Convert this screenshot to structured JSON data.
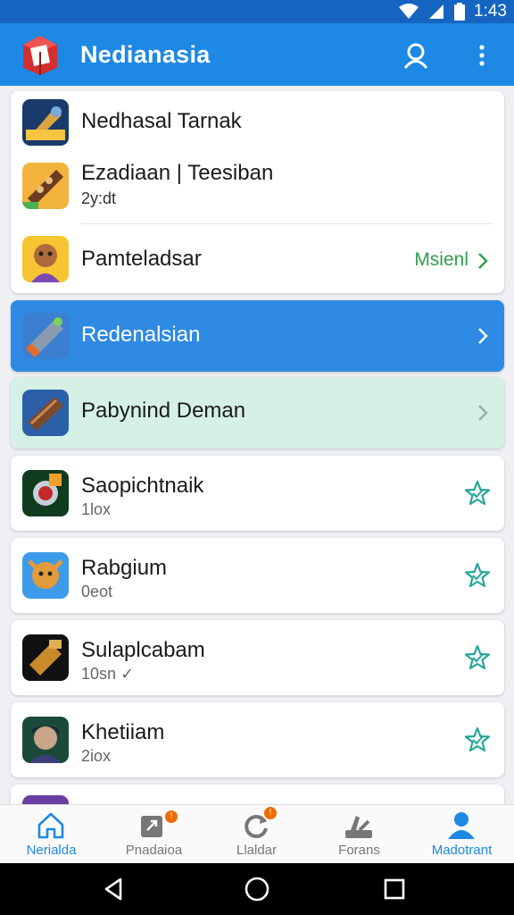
{
  "status_bar": {
    "time": "1:43"
  },
  "app_bar": {
    "title": "Nedianasia"
  },
  "list": {
    "group_card": {
      "header_title": "Nedhasal Tarnak",
      "item1_title": "Ezadiaan | Teesiban",
      "item1_sub": "2y:dt",
      "item2_title": "Pamteladsar",
      "item2_action": "Msienl"
    },
    "selected_row_title": "Redenalsian",
    "highlight_row_title": "Pabynind Deman",
    "items": [
      {
        "title": "Saopichtnaik",
        "sub": "1lox"
      },
      {
        "title": "Rabgium",
        "sub": "0eot"
      },
      {
        "title": "Sulaplcabam",
        "sub": "10sn ✓"
      },
      {
        "title": "Khetiiam",
        "sub": "2iox"
      }
    ]
  },
  "bottom_nav": {
    "items": [
      {
        "label": "Nerialda"
      },
      {
        "label": "Pnadaioa",
        "badge": "!"
      },
      {
        "label": "Llaldar",
        "badge": "!"
      },
      {
        "label": "Forans"
      },
      {
        "label": "Madotrant"
      }
    ]
  },
  "colors": {
    "primary": "#1e88e5",
    "status_bar": "#1565c0",
    "accent_green": "#2e9e4a",
    "highlight_row": "#d5f1e6"
  }
}
